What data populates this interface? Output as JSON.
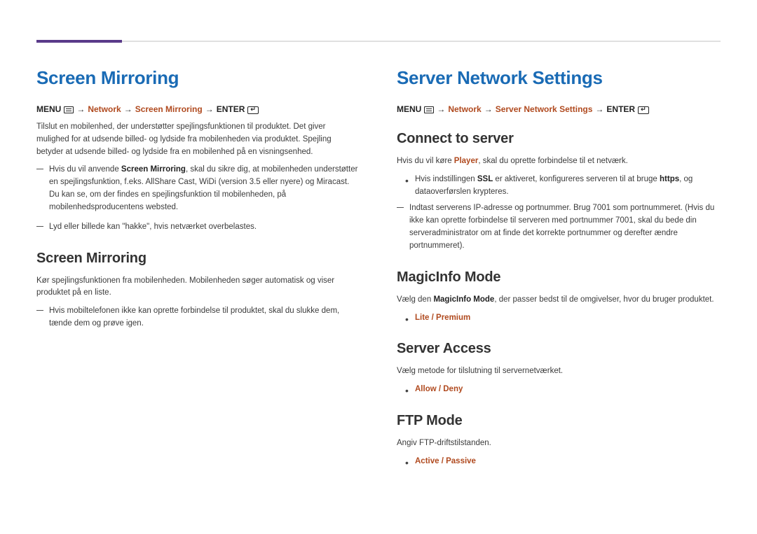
{
  "left": {
    "h1": "Screen Mirroring",
    "bc": {
      "menu": "MENU",
      "p1": "Network",
      "p2": "Screen Mirroring",
      "enter": "ENTER"
    },
    "intro": "Tilslut en mobilenhed, der understøtter spejlingsfunktionen til produktet. Det giver mulighed for at udsende billed- og lydside fra mobilenheden via produktet. Spejling betyder at udsende billed- og lydside fra en mobilenhed på en visningsenhed.",
    "notes": {
      "n1a": "Hvis du vil anvende ",
      "n1b": "Screen Mirroring",
      "n1c": ", skal du sikre dig, at mobilenheden understøtter en spejlingsfunktion, f.eks. AllShare Cast, WiDi (version 3.5 eller nyere) og Miracast. Du kan se, om der findes en spejlingsfunktion til mobilenheden, på mobilenhedsproducentens websted.",
      "n2": "Lyd eller billede kan \"hakke\", hvis netværket overbelastes."
    },
    "sub": {
      "h2": "Screen Mirroring",
      "p": "Kør spejlingsfunktionen fra mobilenheden. Mobilenheden søger automatisk og viser produktet på en liste.",
      "note": "Hvis mobiltelefonen ikke kan oprette forbindelse til produktet, skal du slukke dem, tænde dem og prøve igen."
    }
  },
  "right": {
    "h1": "Server Network Settings",
    "bc": {
      "menu": "MENU",
      "p1": "Network",
      "p2": "Server Network Settings",
      "enter": "ENTER"
    },
    "connect": {
      "h2": "Connect to server",
      "p_a": "Hvis du vil køre ",
      "p_b": "Player",
      "p_c": ", skal du oprette forbindelse til et netværk.",
      "b1a": "Hvis indstillingen ",
      "b1b": "SSL",
      "b1c": " er aktiveret, konfigureres serveren til at bruge ",
      "b1d": "https",
      "b1e": ", og dataoverførslen krypteres.",
      "note": "Indtast serverens IP-adresse og portnummer. Brug 7001 som portnummeret. (Hvis du ikke kan oprette forbindelse til serveren med portnummer 7001, skal du bede din serveradministrator om at finde det korrekte portnummer og derefter ændre portnummeret)."
    },
    "mode": {
      "h2": "MagicInfo Mode",
      "p_a": "Vælg den ",
      "p_b": "MagicInfo Mode",
      "p_c": ", der passer bedst til de omgivelser, hvor du bruger produktet.",
      "opt": "Lite / Premium"
    },
    "access": {
      "h2": "Server Access",
      "p": "Vælg metode for tilslutning til servernetværket.",
      "opt": "Allow / Deny"
    },
    "ftp": {
      "h2": "FTP Mode",
      "p": "Angiv FTP-driftstilstanden.",
      "opt": "Active / Passive"
    }
  }
}
